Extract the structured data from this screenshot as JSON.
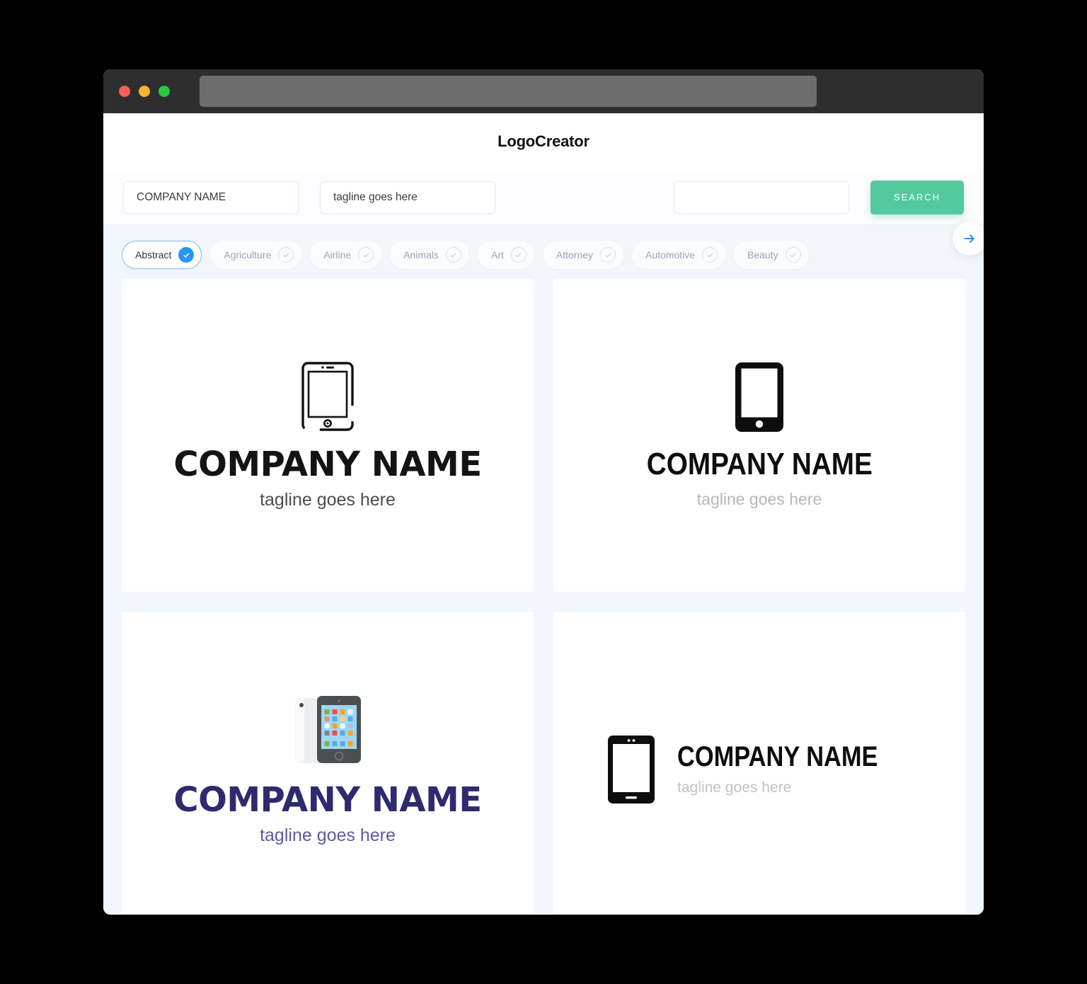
{
  "window": {
    "traffic_lights": [
      "close",
      "minimize",
      "maximize"
    ],
    "url_value": ""
  },
  "header": {
    "brand": "LogoCreator"
  },
  "search": {
    "company_value": "COMPANY NAME",
    "tagline_value": "tagline goes here",
    "third_value": "",
    "third_placeholder": "",
    "search_label": "SEARCH"
  },
  "categories": {
    "items": [
      {
        "label": "Abstract",
        "selected": true
      },
      {
        "label": "Agriculture",
        "selected": false
      },
      {
        "label": "Airline",
        "selected": false
      },
      {
        "label": "Animals",
        "selected": false
      },
      {
        "label": "Art",
        "selected": false
      },
      {
        "label": "Attorney",
        "selected": false
      },
      {
        "label": "Automotive",
        "selected": false
      },
      {
        "label": "Beauty",
        "selected": false
      }
    ],
    "next_icon": "arrow-right-icon"
  },
  "results": [
    {
      "icon": "tablet-outline-icon",
      "name": "COMPANY NAME",
      "tagline": "tagline goes here",
      "name_color": "#141414",
      "tagline_color": "#4d4d4d",
      "layout": "vertical"
    },
    {
      "icon": "tablet-solid-icon",
      "name": "COMPANY NAME",
      "tagline": "tagline goes here",
      "name_color": "#0d0d0d",
      "tagline_color": "#b7b7b7",
      "layout": "vertical"
    },
    {
      "icon": "tablet-color-apps-icon",
      "name": "COMPANY NAME",
      "tagline": "tagline goes here",
      "name_color": "#2e2a6e",
      "tagline_color": "#5b5ba0",
      "layout": "vertical"
    },
    {
      "icon": "tablet-solid-bar-icon",
      "name": "COMPANY NAME",
      "tagline": "tagline goes here",
      "name_color": "#0d0d0d",
      "tagline_color": "#c2c2c2",
      "layout": "horizontal"
    }
  ],
  "colors": {
    "accent_green": "#54c9a0",
    "accent_blue": "#2b96f0",
    "page_bg": "#f4f6fd",
    "titlebar": "#2e2e2e",
    "navy": "#2e2a6e"
  }
}
